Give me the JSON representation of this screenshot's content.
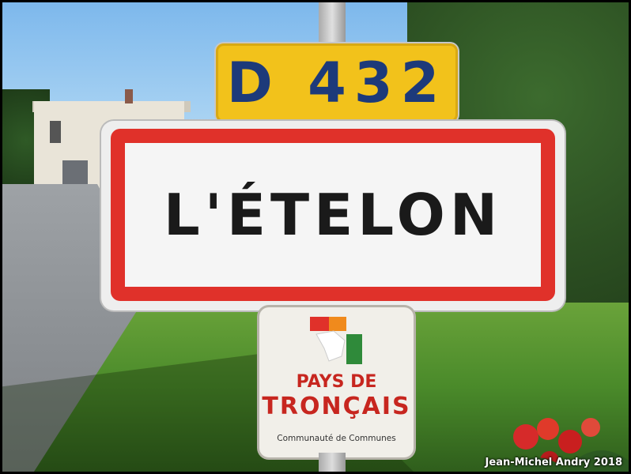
{
  "road_number_sign": {
    "text": "D 432",
    "background": "#f2c21b",
    "text_color": "#1d3a7a"
  },
  "town_sign": {
    "name": "L'ÉTELON",
    "border_color": "#e0312a"
  },
  "community_sign": {
    "line1": "PAYS DE",
    "line2": "TRONÇAIS",
    "line3": "Communauté de Communes",
    "logo": "tronçais-leaf-logo",
    "text_color": "#c7261f"
  },
  "credit": "Jean-Michel Andry 2018"
}
